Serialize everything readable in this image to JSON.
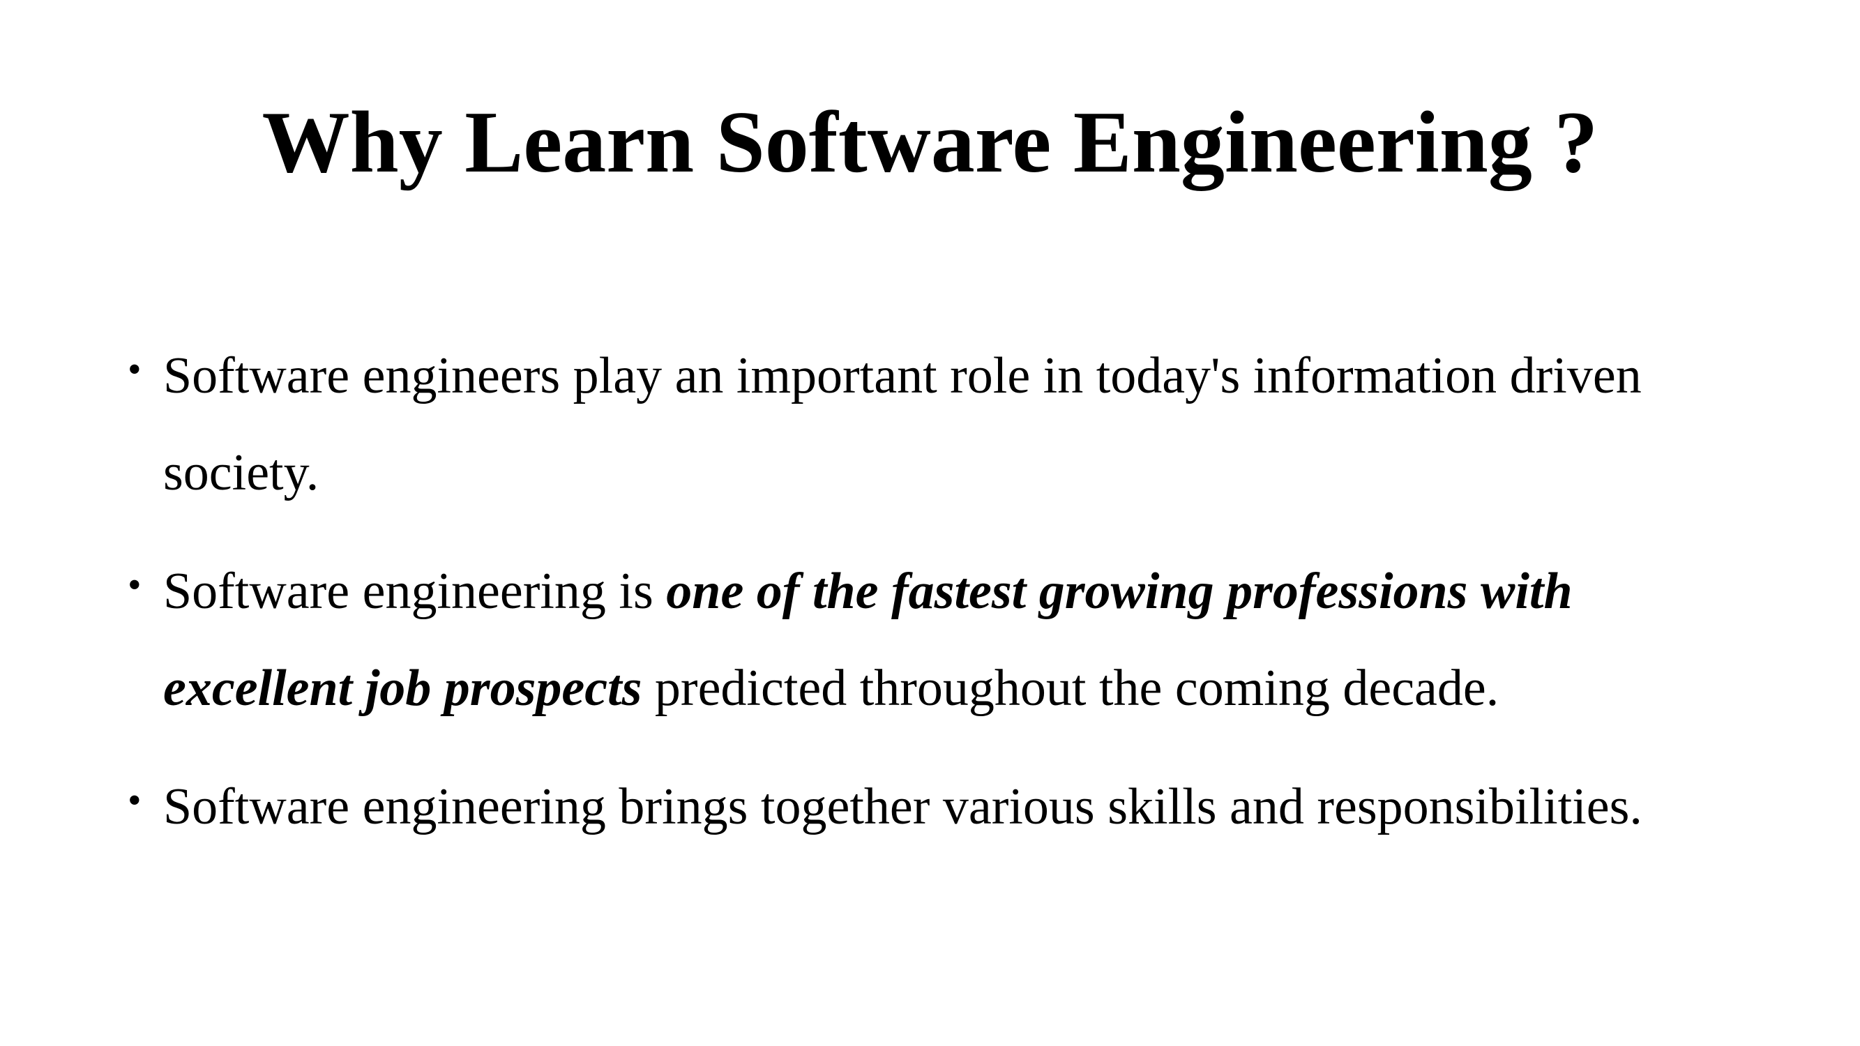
{
  "slide": {
    "title": "Why Learn Software Engineering ?",
    "bullet_glyph": "•",
    "bullets": [
      {
        "text": "Software engineers play an important role in today's information driven society."
      },
      {
        "before": "Software engineering is ",
        "emphasis": "one of the fastest growing professions with excellent job prospects",
        "after": " predicted throughout the coming decade."
      },
      {
        "text": "Software engineering brings together various skills and responsibilities."
      }
    ]
  }
}
